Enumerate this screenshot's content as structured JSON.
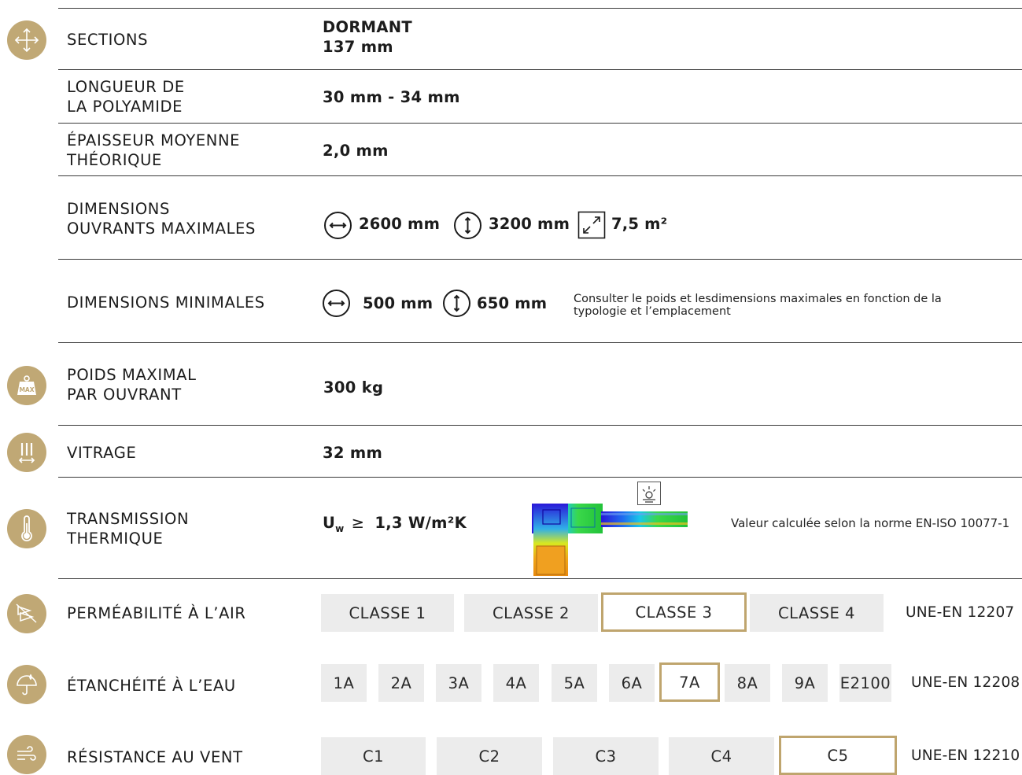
{
  "rows": {
    "sections": {
      "label": "SECTIONS",
      "value_line1": "DORMANT",
      "value_line2": "137 mm"
    },
    "polyamide": {
      "label_line1": "LONGUEUR DE",
      "label_line2": "LA POLYAMIDE",
      "value": "30 mm - 34 mm"
    },
    "epaisseur": {
      "label_line1": "ÉPAISSEUR MOYENNE",
      "label_line2": "THÉORIQUE",
      "value": "2,0 mm"
    },
    "dim_max": {
      "label_line1": "DIMENSIONS",
      "label_line2": "OUVRANTS MAXIMALES",
      "width": "2600 mm",
      "height": "3200 mm",
      "area": "7,5 m²"
    },
    "dim_min": {
      "label": "DIMENSIONS MINIMALES",
      "width": "500 mm",
      "height": "650 mm",
      "note_line1": "Consulter le poids et lesdimensions maximales en fonction de la",
      "note_line2": "typologie et l’emplacement"
    },
    "poids": {
      "label_line1": "POIDS MAXIMAL",
      "label_line2": "PAR OUVRANT",
      "value": "300 kg",
      "icon_text": "MAX"
    },
    "vitrage": {
      "label": "VITRAGE",
      "value": "32 mm"
    },
    "thermique": {
      "label_line1": "TRANSMISSION",
      "label_line2": "THERMIQUE",
      "u": "U",
      "sub": "w",
      "ge": "≥",
      "value": "1,3 W/m²K",
      "note": "Valeur calculée selon la norme EN-ISO 10077-1"
    },
    "air": {
      "label": "PERMÉABILITÉ À L’AIR",
      "classes": [
        "CLASSE 1",
        "CLASSE 2",
        "CLASSE 3",
        "CLASSE 4"
      ],
      "selected": "CLASSE 3",
      "standard": "UNE-EN 12207"
    },
    "eau": {
      "label": "ÉTANCHÉITÉ À L’EAU",
      "classes": [
        "1A",
        "2A",
        "3A",
        "4A",
        "5A",
        "6A",
        "7A",
        "8A",
        "9A",
        "E2100"
      ],
      "selected": "7A",
      "standard": "UNE-EN 12208"
    },
    "vent": {
      "label": "RÉSISTANCE AU VENT",
      "classes": [
        "C1",
        "C2",
        "C3",
        "C4",
        "C5"
      ],
      "selected": "C5",
      "standard": "UNE-EN 12210"
    }
  },
  "colors": {
    "accent": "#c0a875",
    "selected_border": "#bfa56e",
    "box_bg": "#ececec"
  }
}
